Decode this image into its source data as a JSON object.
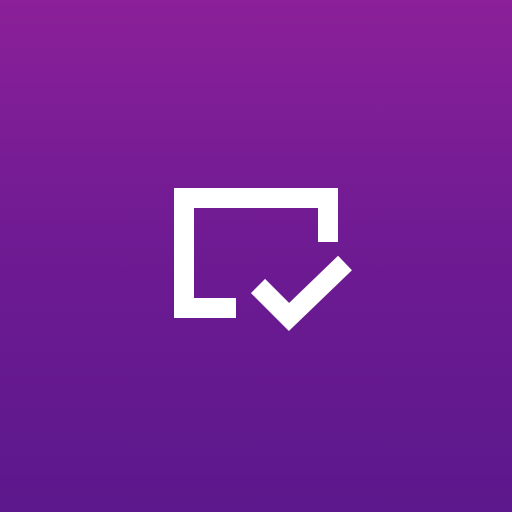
{
  "app_icon": {
    "icon": "window-check-icon",
    "colors": {
      "gradient_top": "#8b2099",
      "gradient_mid": "#701b93",
      "gradient_bottom": "#5c188c",
      "glyph": "#ffffff"
    }
  }
}
